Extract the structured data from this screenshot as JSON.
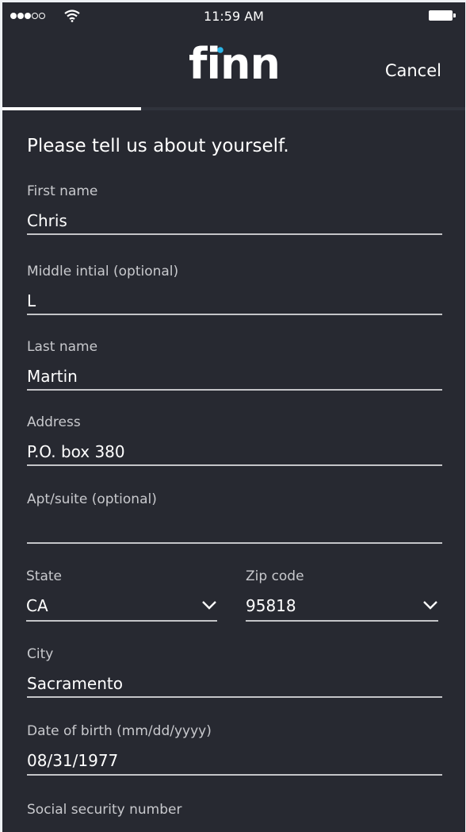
{
  "status_bar": {
    "time": "11:59 AM",
    "signal_bars_filled": 3,
    "signal_bars_total": 5
  },
  "header": {
    "logo_text": "finn",
    "cancel_label": "Cancel",
    "progress_fraction": 0.3
  },
  "form": {
    "heading": "Please tell us about yourself.",
    "first_name": {
      "label": "First name",
      "value": "Chris"
    },
    "middle_initial": {
      "label": "Middle intial (optional)",
      "value": "L"
    },
    "last_name": {
      "label": "Last name",
      "value": "Martin"
    },
    "address": {
      "label": "Address",
      "value": "P.O. box 380"
    },
    "apt_suite": {
      "label": "Apt/suite (optional)",
      "value": ""
    },
    "state": {
      "label": "State",
      "value": "CA"
    },
    "zip_code": {
      "label": "Zip code",
      "value": "95818"
    },
    "city": {
      "label": "City",
      "value": "Sacramento"
    },
    "date_of_birth": {
      "label": "Date of birth (mm/dd/yyyy)",
      "value": "08/31/1977"
    },
    "ssn": {
      "label": "Social security number"
    }
  },
  "colors": {
    "background": "#272931",
    "accent_dot": "#2bb5e8",
    "text": "#ffffff",
    "label": "#c8c9cd",
    "underline": "#c4c5c8"
  }
}
